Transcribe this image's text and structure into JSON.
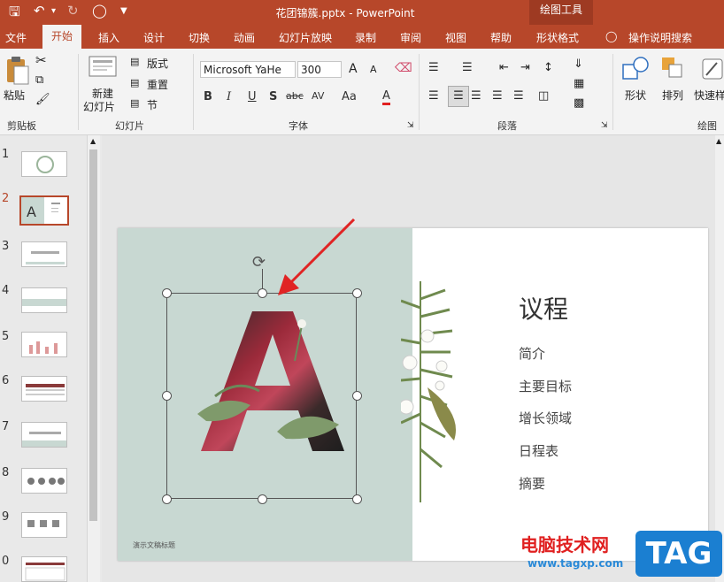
{
  "titlebar": {
    "doc_title": "花团锦簇.pptx - PowerPoint",
    "tools_title": "绘图工具",
    "save_icon": "save-icon",
    "undo_icon": "undo-icon",
    "redo_icon": "redo-icon",
    "present_icon": "present-from-start-icon",
    "customize_icon": "customize-qat-icon"
  },
  "tabs": [
    "文件",
    "开始",
    "插入",
    "设计",
    "切换",
    "动画",
    "幻灯片放映",
    "录制",
    "审阅",
    "视图",
    "帮助",
    "形状格式"
  ],
  "tell_me": "操作说明搜索",
  "ribbon": {
    "clipboard": {
      "paste": "粘贴",
      "label": "剪贴板"
    },
    "slides": {
      "new_slide": "新建",
      "new_slide2": "幻灯片",
      "layout": "版式",
      "reset": "重置",
      "section": "节",
      "label": "幻灯片"
    },
    "font": {
      "name": "Microsoft YaHe",
      "size": "300",
      "label": "字体",
      "bold": "B",
      "italic": "I",
      "underline": "U",
      "shadow": "S",
      "strike": "abc",
      "spacing": "AV",
      "case": "Aa",
      "color": "A",
      "grow": "A",
      "shrink": "A"
    },
    "paragraph": {
      "label": "段落"
    },
    "drawing": {
      "shapes": "形状",
      "arrange": "排列",
      "quickstyles": "快速样",
      "label": "绘图"
    }
  },
  "slide_numbers": [
    "1",
    "2",
    "3",
    "4",
    "5",
    "6",
    "7",
    "8",
    "9",
    "0"
  ],
  "slide": {
    "agenda_title": "议程",
    "agenda_items": [
      "简介",
      "主要目标",
      "增长领域",
      "日程表",
      "摘要"
    ],
    "footer": "演示文稿标题",
    "big_letter": "A"
  },
  "watermark": {
    "text": "电脑技术网",
    "url": "www.tagxp.com",
    "tag": "TAG"
  },
  "colors": {
    "accent": "#b7472a",
    "slide_left_bg": "#c8d8d2",
    "arrow": "#e02424"
  }
}
